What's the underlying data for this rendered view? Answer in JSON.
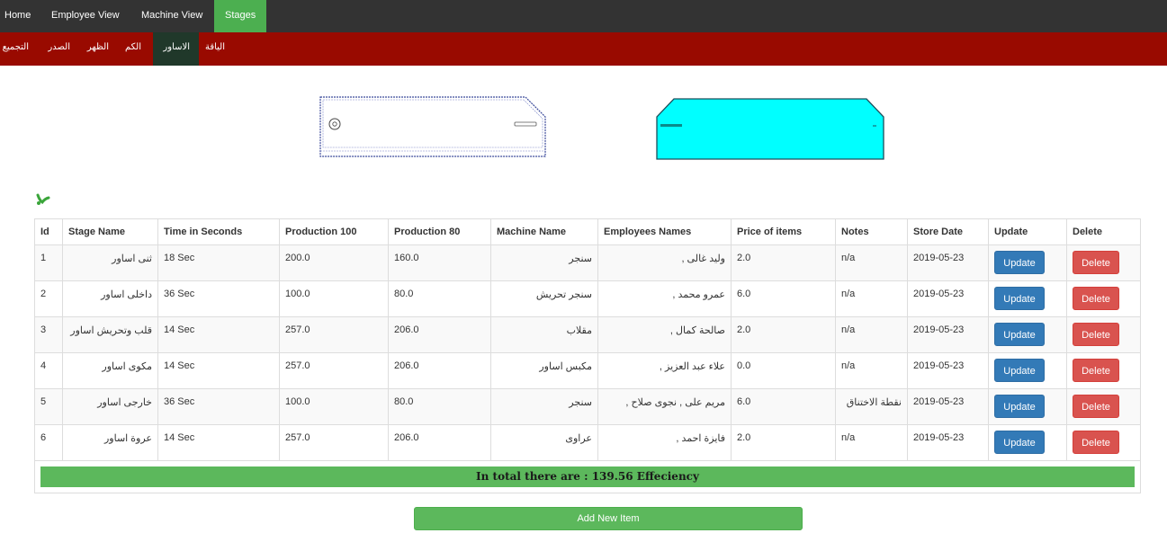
{
  "topnav": {
    "items": [
      "Home",
      "Employee View",
      "Machine View",
      "Stages"
    ],
    "active": "Stages",
    "active_color": "#4caf50"
  },
  "subnav": {
    "items": [
      "التجميع",
      "الصدر",
      "الظهر",
      "الكم",
      "الاساور",
      "الياقة"
    ],
    "active": "الاساور",
    "bar_color": "#990a00"
  },
  "efficiency_icon": "efficiency-icon",
  "table": {
    "headers": [
      "Id",
      "Stage Name",
      "Time in Seconds",
      "Production 100",
      "Production 80",
      "Machine Name",
      "Employees Names",
      "Price of items",
      "Notes",
      "Store Date",
      "Update",
      "Delete"
    ],
    "rows": [
      {
        "id": "1",
        "stage": "ثنى اساور",
        "time": "18 Sec",
        "p100": "200.0",
        "p80": "160.0",
        "machine": "سنجر",
        "employees": "وليد غالى ,",
        "price": "2.0",
        "notes": "n/a",
        "date": "2019-05-23"
      },
      {
        "id": "2",
        "stage": "داخلى اساور",
        "time": "36 Sec",
        "p100": "100.0",
        "p80": "80.0",
        "machine": "سنجر تحريش",
        "employees": "عمرو محمد ,",
        "price": "6.0",
        "notes": "n/a",
        "date": "2019-05-23"
      },
      {
        "id": "3",
        "stage": "قلب وتحريش اساور",
        "time": "14 Sec",
        "p100": "257.0",
        "p80": "206.0",
        "machine": "مقلاب",
        "employees": "صالحة كمال ,",
        "price": "2.0",
        "notes": "n/a",
        "date": "2019-05-23"
      },
      {
        "id": "4",
        "stage": "مكوى اساور",
        "time": "14 Sec",
        "p100": "257.0",
        "p80": "206.0",
        "machine": "مكبس اساور",
        "employees": "علاء عبد العزيز ,",
        "price": "0.0",
        "notes": "n/a",
        "date": "2019-05-23"
      },
      {
        "id": "5",
        "stage": "خارجى اساور",
        "time": "36 Sec",
        "p100": "100.0",
        "p80": "80.0",
        "machine": "سنجر",
        "employees": "مريم على , نجوى صلاح ,",
        "price": "6.0",
        "notes": "نقطة الاختناق",
        "date": "2019-05-23"
      },
      {
        "id": "6",
        "stage": "عروة اساور",
        "time": "14 Sec",
        "p100": "257.0",
        "p80": "206.0",
        "machine": "عراوى",
        "employees": "فايزة احمد ,",
        "price": "2.0",
        "notes": "n/a",
        "date": "2019-05-23"
      }
    ],
    "update_label": "Update",
    "delete_label": "Delete",
    "total_text": "In total there are : 139.56 Effeciency"
  },
  "add_button_label": "Add New Item",
  "colors": {
    "topnav_bg": "#333333",
    "update_btn": "#337ab7",
    "delete_btn": "#d9534f",
    "success": "#5cb85c",
    "part_fill": "#00ffff"
  }
}
